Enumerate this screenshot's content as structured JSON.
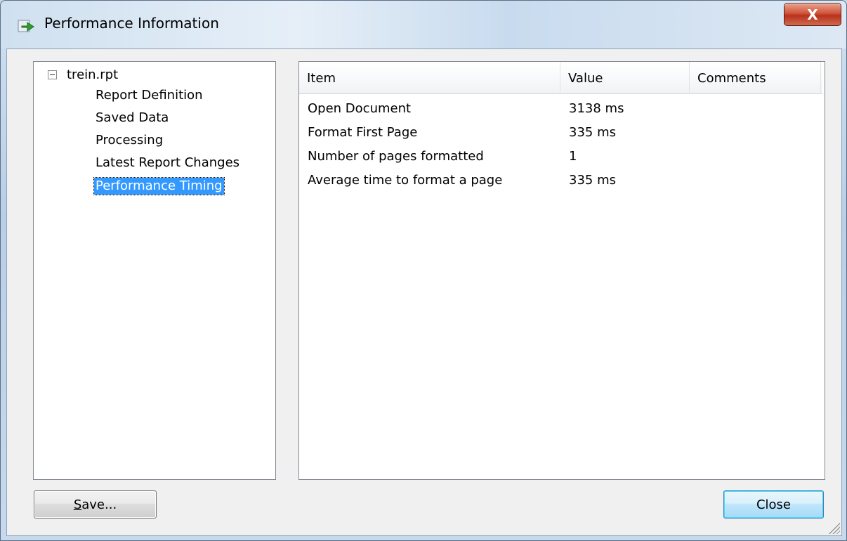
{
  "window": {
    "title": "Performance Information",
    "close_glyph": "X"
  },
  "tree": {
    "root_label": "trein.rpt",
    "items": [
      {
        "label": "Report Definition",
        "selected": false
      },
      {
        "label": "Saved Data",
        "selected": false
      },
      {
        "label": "Processing",
        "selected": false
      },
      {
        "label": "Latest Report Changes",
        "selected": false
      },
      {
        "label": "Performance Timing",
        "selected": true
      }
    ]
  },
  "list": {
    "columns": [
      "Item",
      "Value",
      "Comments"
    ],
    "rows": [
      {
        "item": "Open Document",
        "value": "3138  ms",
        "comments": ""
      },
      {
        "item": "Format First Page",
        "value": "335  ms",
        "comments": ""
      },
      {
        "item": "Number of pages formatted",
        "value": "1",
        "comments": ""
      },
      {
        "item": "Average time to format a page",
        "value": "335  ms",
        "comments": ""
      }
    ]
  },
  "buttons": {
    "save_label_mnemonic": "S",
    "save_label_rest": "ave...",
    "close_label": "Close"
  },
  "colors": {
    "selection": "#3399ff",
    "default_button_border": "#3c7fb1"
  }
}
